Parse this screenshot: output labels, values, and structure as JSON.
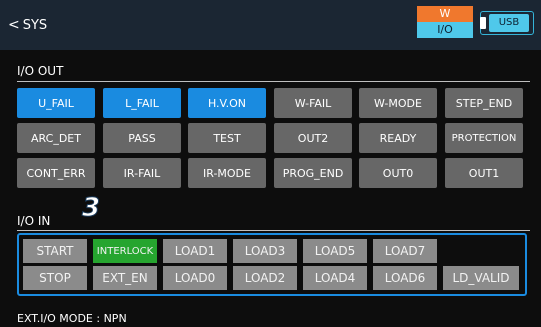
{
  "header": {
    "back_label": "SYS",
    "w_label": "W",
    "io_label": "I/O",
    "usb_label": "USB"
  },
  "io_out": {
    "title": "I/O OUT",
    "rows": [
      [
        {
          "label": "U_FAIL",
          "on": true
        },
        {
          "label": "L_FAIL",
          "on": true
        },
        {
          "label": "H.V.ON",
          "on": true
        },
        {
          "label": "W-FAIL",
          "on": false
        },
        {
          "label": "W-MODE",
          "on": false
        },
        {
          "label": "STEP_END",
          "on": false
        }
      ],
      [
        {
          "label": "ARC_DET",
          "on": false
        },
        {
          "label": "PASS",
          "on": false
        },
        {
          "label": "TEST",
          "on": false
        },
        {
          "label": "OUT2",
          "on": false
        },
        {
          "label": "READY",
          "on": false
        },
        {
          "label": "PROTECTION",
          "on": false
        }
      ],
      [
        {
          "label": "CONT_ERR",
          "on": false
        },
        {
          "label": "IR-FAIL",
          "on": false
        },
        {
          "label": "IR-MODE",
          "on": false
        },
        {
          "label": "PROG_END",
          "on": false
        },
        {
          "label": "OUT0",
          "on": false
        },
        {
          "label": "OUT1",
          "on": false
        }
      ]
    ]
  },
  "io_in": {
    "title": "I/O IN",
    "callout": "3",
    "rows": [
      [
        {
          "label": "START",
          "active": false
        },
        {
          "label": "INTERLOCK",
          "active": true
        },
        {
          "label": "LOAD1",
          "active": false
        },
        {
          "label": "LOAD3",
          "active": false
        },
        {
          "label": "LOAD5",
          "active": false
        },
        {
          "label": "LOAD7",
          "active": false
        },
        {
          "label": "",
          "active": false
        }
      ],
      [
        {
          "label": "STOP",
          "active": false
        },
        {
          "label": "EXT_EN",
          "active": false
        },
        {
          "label": "LOAD0",
          "active": false
        },
        {
          "label": "LOAD2",
          "active": false
        },
        {
          "label": "LOAD4",
          "active": false
        },
        {
          "label": "LOAD6",
          "active": false
        },
        {
          "label": "LD_VALID",
          "active": false
        }
      ]
    ]
  },
  "footer": {
    "mode_text": "EXT.I/O MODE : NPN"
  },
  "colors": {
    "on": "#1a8be0",
    "off": "#676767",
    "input_active": "#26a52f",
    "input_idle": "#8b8b8b",
    "w_accent": "#f0782d",
    "io_accent": "#4fc8ea"
  }
}
